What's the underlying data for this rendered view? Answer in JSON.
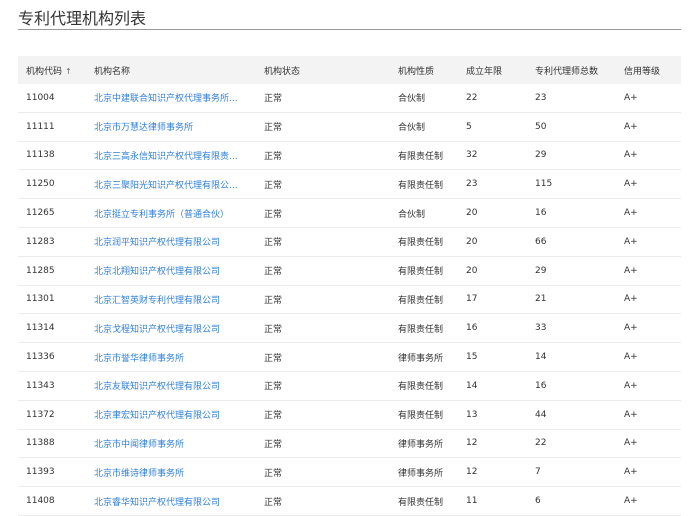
{
  "title": "专利代理机构列表",
  "columns": {
    "code": "机构代码",
    "name": "机构名称",
    "status": "机构状态",
    "nature": "机构性质",
    "years": "成立年限",
    "agents": "专利代理师总数",
    "credit": "信用等级"
  },
  "sort_icon": "↑",
  "rows": [
    {
      "code": "11004",
      "name": "北京中建联合知识产权代理事务所...",
      "status": "正常",
      "nature": "合伙制",
      "years": "22",
      "agents": "23",
      "credit": "A+"
    },
    {
      "code": "11111",
      "name": "北京市万慧达律师事务所",
      "status": "正常",
      "nature": "合伙制",
      "years": "5",
      "agents": "50",
      "credit": "A+"
    },
    {
      "code": "11138",
      "name": "北京三高永信知识产权代理有限责...",
      "status": "正常",
      "nature": "有限责任制",
      "years": "32",
      "agents": "29",
      "credit": "A+"
    },
    {
      "code": "11250",
      "name": "北京三聚阳光知识产权代理有限公...",
      "status": "正常",
      "nature": "有限责任制",
      "years": "23",
      "agents": "115",
      "credit": "A+"
    },
    {
      "code": "11265",
      "name": "北京挺立专利事务所（普通合伙）",
      "status": "正常",
      "nature": "合伙制",
      "years": "20",
      "agents": "16",
      "credit": "A+"
    },
    {
      "code": "11283",
      "name": "北京润平知识产权代理有限公司",
      "status": "正常",
      "nature": "有限责任制",
      "years": "20",
      "agents": "66",
      "credit": "A+"
    },
    {
      "code": "11285",
      "name": "北京北翔知识产权代理有限公司",
      "status": "正常",
      "nature": "有限责任制",
      "years": "20",
      "agents": "29",
      "credit": "A+"
    },
    {
      "code": "11301",
      "name": "北京汇智英财专利代理有限公司",
      "status": "正常",
      "nature": "有限责任制",
      "years": "17",
      "agents": "21",
      "credit": "A+"
    },
    {
      "code": "11314",
      "name": "北京戈程知识产权代理有限公司",
      "status": "正常",
      "nature": "有限责任制",
      "years": "16",
      "agents": "33",
      "credit": "A+"
    },
    {
      "code": "11336",
      "name": "北京市誉华律师事务所",
      "status": "正常",
      "nature": "律师事务所",
      "years": "15",
      "agents": "14",
      "credit": "A+"
    },
    {
      "code": "11343",
      "name": "北京友联知识产权代理有限公司",
      "status": "正常",
      "nature": "有限责任制",
      "years": "14",
      "agents": "16",
      "credit": "A+"
    },
    {
      "code": "11372",
      "name": "北京聿宏知识产权代理有限公司",
      "status": "正常",
      "nature": "有限责任制",
      "years": "13",
      "agents": "44",
      "credit": "A+"
    },
    {
      "code": "11388",
      "name": "北京市中闻律师事务所",
      "status": "正常",
      "nature": "律师事务所",
      "years": "12",
      "agents": "22",
      "credit": "A+"
    },
    {
      "code": "11393",
      "name": "北京市维诗律师事务所",
      "status": "正常",
      "nature": "律师事务所",
      "years": "12",
      "agents": "7",
      "credit": "A+"
    },
    {
      "code": "11408",
      "name": "北京睿华知识产权代理有限公司",
      "status": "正常",
      "nature": "有限责任制",
      "years": "11",
      "agents": "6",
      "credit": "A+"
    }
  ]
}
